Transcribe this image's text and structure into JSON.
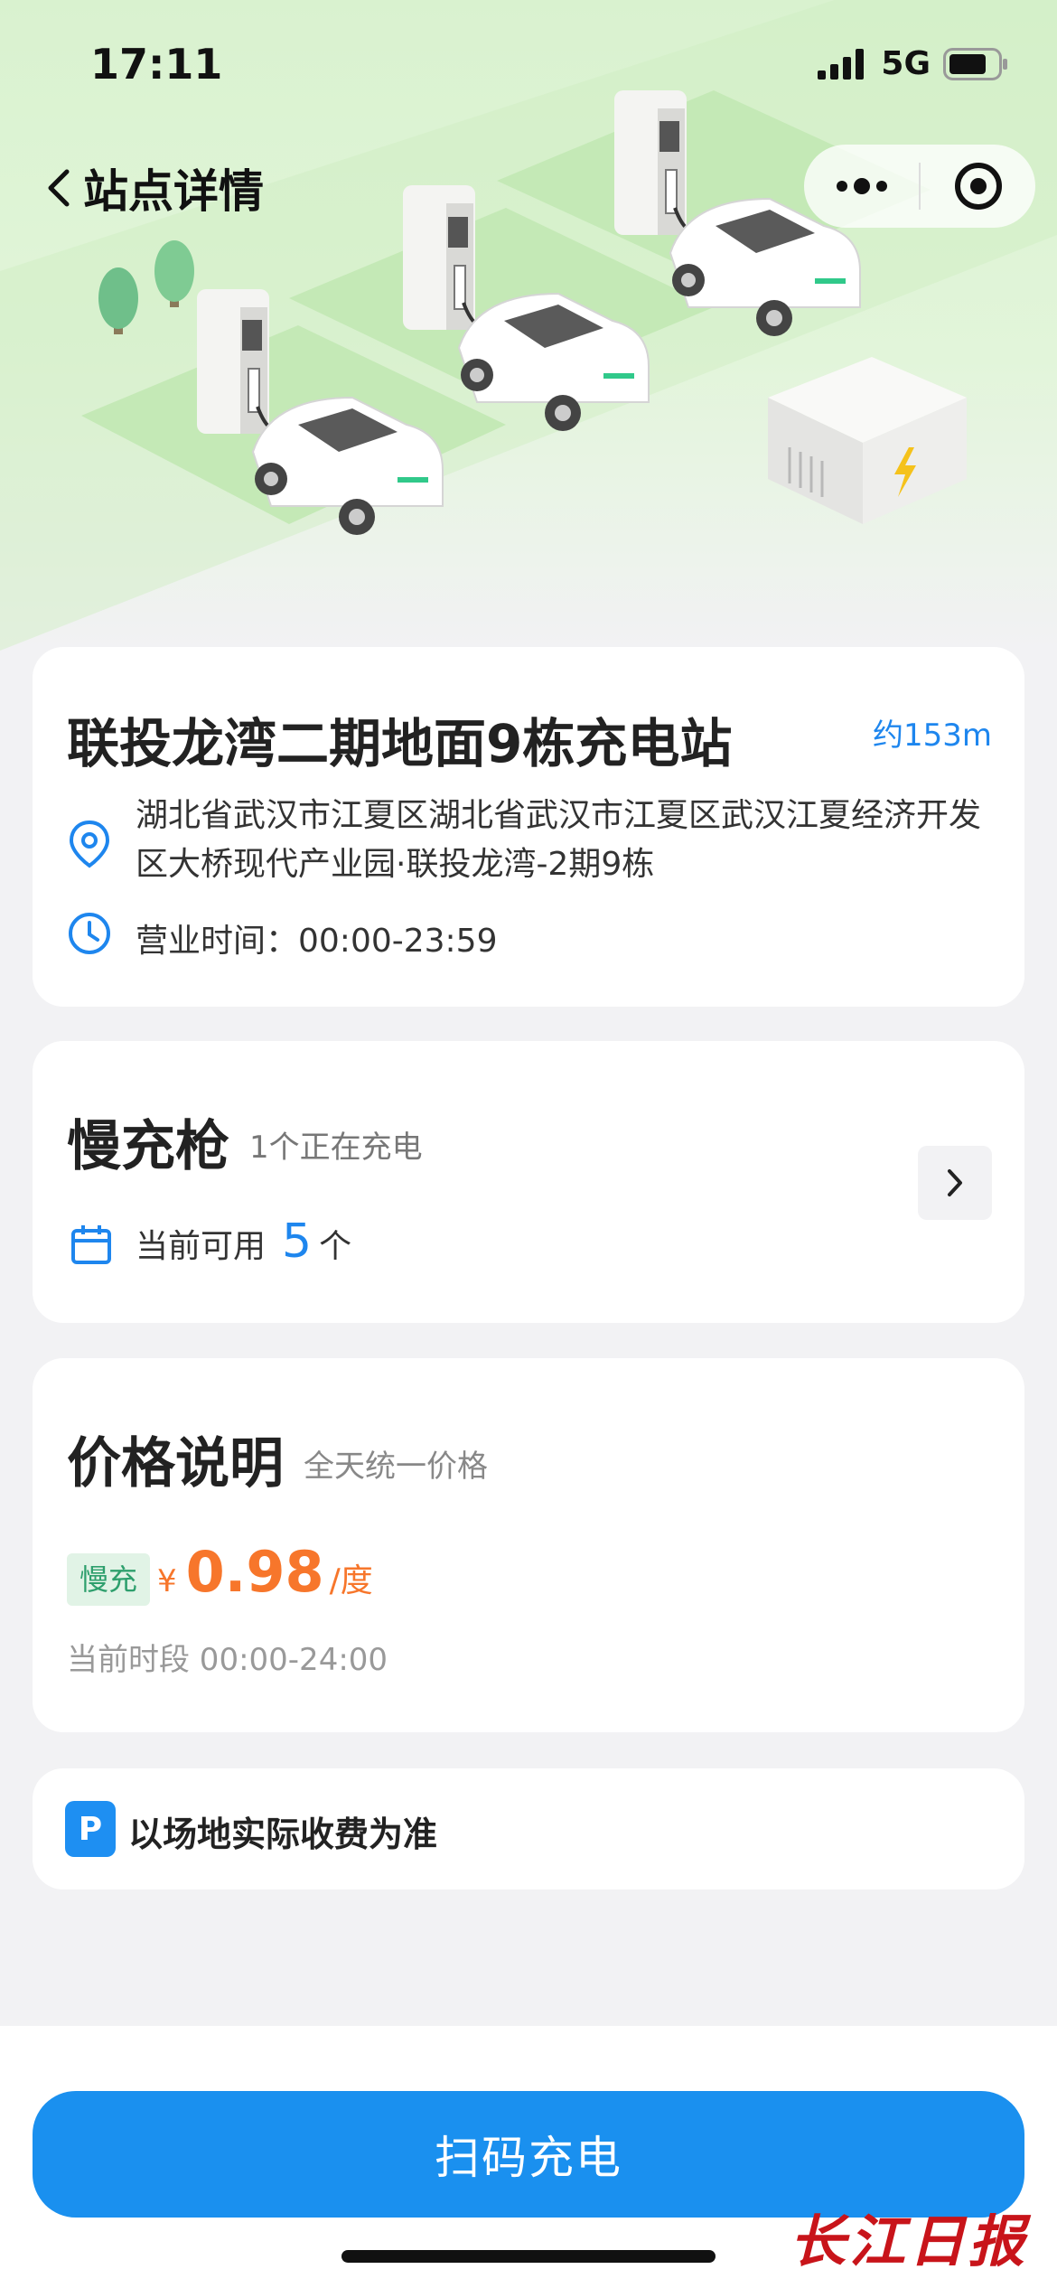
{
  "status_bar": {
    "time": "17:11",
    "network": "5G"
  },
  "nav": {
    "title": "站点详情"
  },
  "station": {
    "name": "联投龙湾二期地面9栋充电站",
    "distance": "约153m",
    "address": "湖北省武汉市江夏区湖北省武汉市江夏区武汉江夏经济开发区大桥现代产业园·联投龙湾-2期9栋",
    "hours": "营业时间：00:00-23:59"
  },
  "slow_charger": {
    "title": "慢充枪",
    "subtitle": "1个正在充电",
    "available_label": "当前可用",
    "available_count": "5",
    "available_unit": "个"
  },
  "pricing": {
    "title": "价格说明",
    "subtitle": "全天统一价格",
    "tag": "慢充",
    "currency": "¥",
    "price": "0.98",
    "unit": "/度",
    "period": "当前时段 00:00-24:00"
  },
  "parking": {
    "badge": "P",
    "note": "以场地实际收费为准"
  },
  "action": {
    "scan_label": "扫码充电"
  },
  "watermark": {
    "text": "长江日报"
  },
  "colors": {
    "accent": "#1e86ee",
    "price": "#f7762b",
    "tag_bg": "#e1f3e6",
    "tag_text": "#2e9f6d"
  }
}
